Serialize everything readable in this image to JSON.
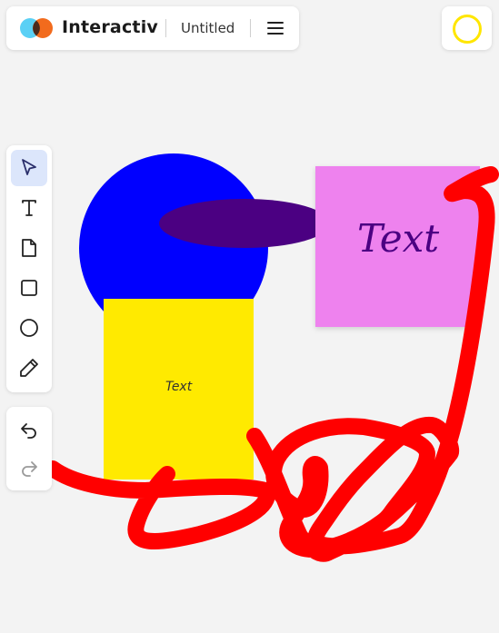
{
  "header": {
    "brand": "Interactiv",
    "document_title": "Untitled"
  },
  "icons": {
    "logo": "two-circle-logo-icon",
    "menu": "hamburger-menu-icon",
    "user": "user-ring-icon",
    "select": "cursor-arrow-icon",
    "text": "text-tool-icon",
    "sticky": "sticky-note-icon",
    "rectangle": "rectangle-icon",
    "ellipse": "circle-icon",
    "pen": "pencil-icon",
    "undo": "undo-icon",
    "redo": "redo-icon"
  },
  "canvas": {
    "sticky_note_text": "Text",
    "yellow_box_text": "Text"
  },
  "colors": {
    "background": "#f3f3f3",
    "active_tool": "#dce6fb",
    "blue_circle": "#0000ff",
    "purple_ellipse": "#4b0082",
    "yellow_rect": "#ffea00",
    "pink_sticky": "#ee82ee",
    "red_stroke": "#ff0000",
    "user_ring": "#ffe600",
    "logo_left": "#5ad0f5",
    "logo_right": "#f26b1d"
  }
}
